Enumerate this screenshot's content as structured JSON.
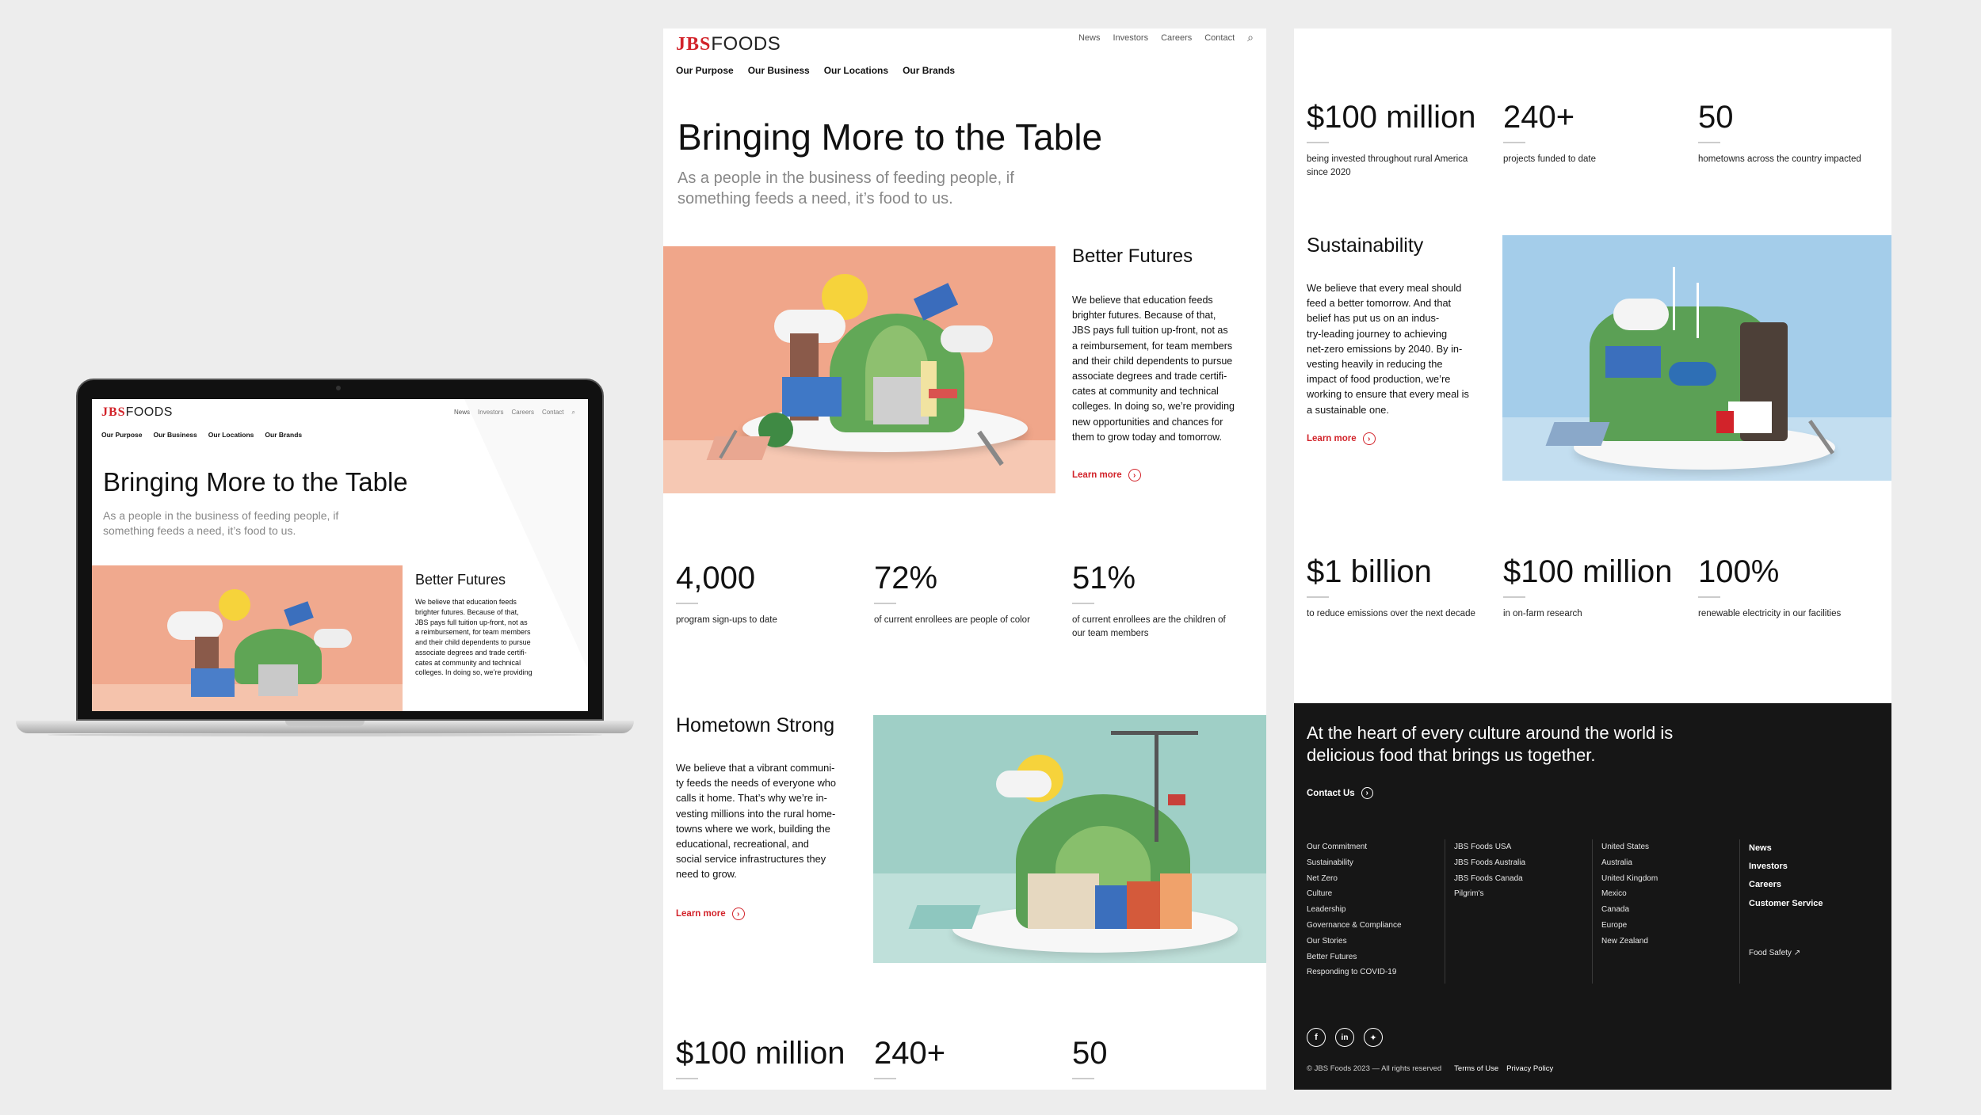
{
  "brand": {
    "jbs": "JBS",
    "foods": "FOODS",
    "accent": "#d2232a"
  },
  "topnav": [
    "News",
    "Investors",
    "Careers",
    "Contact"
  ],
  "mainnav": [
    "Our Purpose",
    "Our Business",
    "Our Locations",
    "Our Brands"
  ],
  "hero": {
    "title": "Bringing More to the Table",
    "subtitle_line1": "As a people in the business of feeding people, if",
    "subtitle_line2": "something feeds a need, it’s food to us."
  },
  "better_futures": {
    "title": "Better Futures",
    "lines": [
      "We believe that education feeds",
      "brighter futures. Because of that,",
      "JBS pays full tuition up-front, not as",
      "a reimbursement, for team members",
      "and their child dependents to pursue",
      "associate degrees and trade certifi-",
      "cates at community and technical",
      "colleges. In doing so, we’re providing",
      "new opportunities and chances for",
      "them to grow today and tomorrow."
    ],
    "learn": "Learn more"
  },
  "stats1": [
    {
      "num": "4,000",
      "label1": "program sign-ups to date",
      "label2": ""
    },
    {
      "num": "72%",
      "label1": "of current enrollees are people of color",
      "label2": ""
    },
    {
      "num": "51%",
      "label1": "of current enrollees are the children of",
      "label2": "our team members"
    }
  ],
  "hometown": {
    "title": "Hometown Strong",
    "lines": [
      "We believe that a vibrant communi-",
      "ty feeds the needs of everyone who",
      "calls it home. That’s why we’re in-",
      "vesting millions into the rural home-",
      "towns where we work, building the",
      "educational, recreational, and",
      "social service infrastructures they",
      "need to grow."
    ],
    "learn": "Learn more"
  },
  "stats2": [
    {
      "num": "$100 million",
      "label1": "being invested throughout rural America",
      "label2": "since 2020"
    },
    {
      "num": "240+",
      "label1": "projects funded to date",
      "label2": ""
    },
    {
      "num": "50",
      "label1": "hometowns across the country impacted",
      "label2": ""
    }
  ],
  "sustainability": {
    "title": "Sustainability",
    "lines": [
      "We believe that every meal should",
      "feed a better tomorrow. And that",
      "belief has put us on an indus-",
      "try-leading journey to achieving",
      "net-zero emissions by 2040. By in-",
      "vesting heavily in reducing the",
      "impact of food production, we’re",
      "working to ensure that every meal is",
      "a sustainable one."
    ],
    "learn": "Learn more"
  },
  "stats3": [
    {
      "num": "$1 billion",
      "label1": "to reduce emissions over the next decade",
      "label2": ""
    },
    {
      "num": "$100 million",
      "label1": "in on-farm research",
      "label2": ""
    },
    {
      "num": "100%",
      "label1": "renewable electricity in our facilities",
      "label2": ""
    }
  ],
  "footer": {
    "tagline1": "At the heart of every culture around the world is",
    "tagline2": "delicious food that brings us together.",
    "contact": "Contact Us",
    "col1": [
      "Our Commitment",
      "Sustainability",
      "Net Zero",
      "Culture",
      "Leadership",
      "Governance & Compliance",
      "Our Stories",
      "Better Futures",
      "Responding to COVID-19"
    ],
    "col2": [
      "JBS Foods USA",
      "JBS Foods Australia",
      "JBS Foods Canada",
      "Pilgrim's"
    ],
    "col3": [
      "United States",
      "Australia",
      "United Kingdom",
      "Mexico",
      "Canada",
      "Europe",
      "New Zealand"
    ],
    "col4": [
      "News",
      "Investors",
      "Careers",
      "Customer Service"
    ],
    "food_safety": "Food Safety ↗",
    "copyright": "© JBS Foods 2023 — All rights reserved",
    "terms": "Terms of Use",
    "privacy": "Privacy Policy"
  }
}
